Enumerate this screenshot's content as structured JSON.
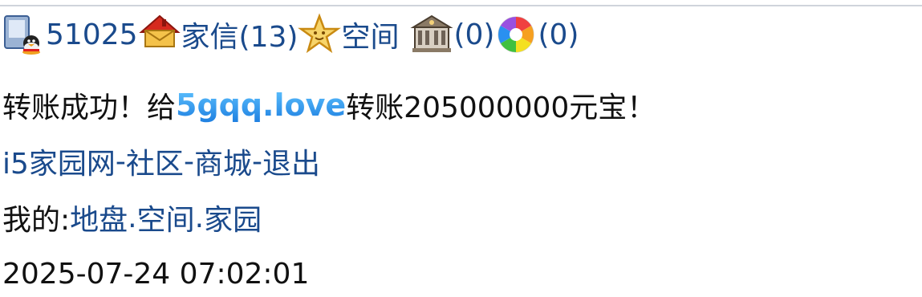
{
  "status_bar": {
    "user_id": "51025",
    "mail_label": "家信(13)",
    "space_label": "空间",
    "home_count": "(0)",
    "album_count": "(0)"
  },
  "message": {
    "prefix": "转账成功！给",
    "recipient": "5gqq.love",
    "suffix": "转账205000000元宝！"
  },
  "nav": {
    "home": "i5家园网",
    "sep": "-",
    "community": "社区",
    "mall": "商城",
    "logout": "退出"
  },
  "my_links": {
    "label": "我的:",
    "land": "地盘",
    "dot": ".",
    "space": "空间",
    "homeland": "家园"
  },
  "timestamp": "2025-07-24 07:02:01",
  "icons": {
    "user": "qq-user-icon",
    "mail": "mail-house-icon",
    "star": "star-icon",
    "building": "building-icon",
    "album": "colorful-aperture-icon"
  },
  "colors": {
    "link": "#1a4a8c",
    "brand_top": "#5fc3ff",
    "brand_bottom": "#1e7fe0",
    "text": "#111111"
  }
}
